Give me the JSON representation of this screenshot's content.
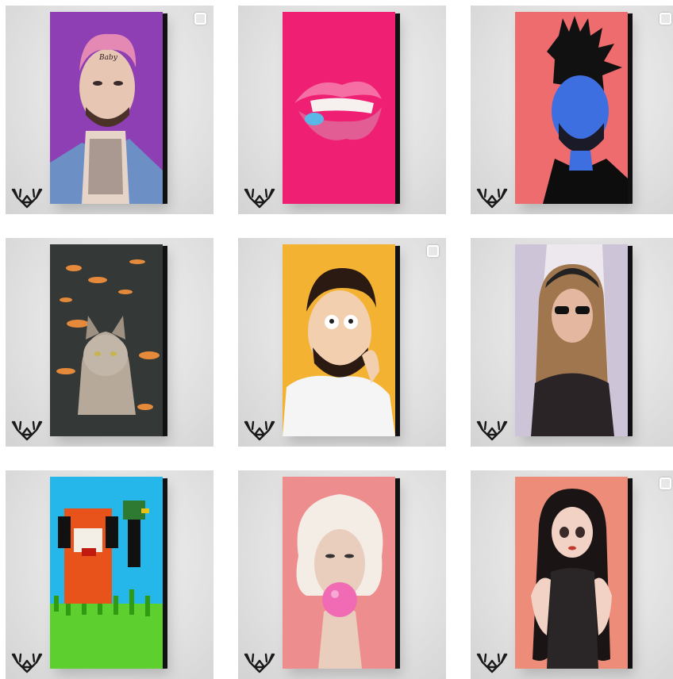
{
  "grid": {
    "posts": [
      {
        "id": "post-1",
        "subject": "tattooed-rapper-portrait",
        "has_multi_icon": true
      },
      {
        "id": "post-2",
        "subject": "bubblegum-lips",
        "has_multi_icon": false
      },
      {
        "id": "post-3",
        "subject": "blue-singer-portrait",
        "has_multi_icon": true
      },
      {
        "id": "post-4",
        "subject": "cat-with-goldfish",
        "has_multi_icon": false
      },
      {
        "id": "post-5",
        "subject": "cartoon-rapper-portrait",
        "has_multi_icon": true
      },
      {
        "id": "post-6",
        "subject": "woman-with-sunglasses",
        "has_multi_icon": false
      },
      {
        "id": "post-7",
        "subject": "pixel-dog-and-duck",
        "has_multi_icon": false
      },
      {
        "id": "post-8",
        "subject": "blonde-bubblegum",
        "has_multi_icon": false
      },
      {
        "id": "post-9",
        "subject": "cartoon-tattooed-woman",
        "has_multi_icon": true
      }
    ]
  },
  "colors": {
    "canvas_purple": "#8e3fb4",
    "canvas_pink": "#ef1f73",
    "canvas_coral": "#ee6b6e",
    "canvas_dark": "#343837",
    "canvas_yellow": "#f4b233",
    "canvas_white": "#ece8ee",
    "canvas_skyblue": "#26b7ea",
    "canvas_rose": "#ee8d8d",
    "canvas_salmon": "#ee8c7a",
    "logo": "#1a1a1a"
  },
  "icons": {
    "multi_post": "multiple-images-icon",
    "brand": "antler-logo-icon"
  }
}
